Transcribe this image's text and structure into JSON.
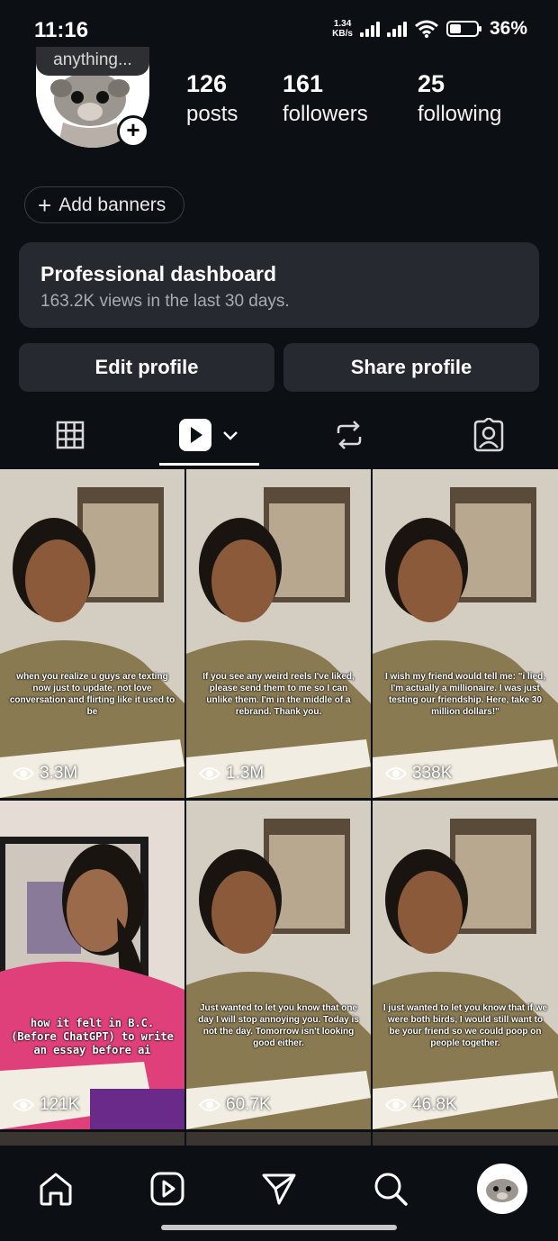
{
  "status_bar": {
    "time": "11:16",
    "net_speed_value": "1.34",
    "net_speed_unit": "KB/s",
    "battery_percent": "36%"
  },
  "profile": {
    "note": "anything...",
    "stats": [
      {
        "value": "126",
        "label": "posts"
      },
      {
        "value": "161",
        "label": "followers"
      },
      {
        "value": "25",
        "label": "following"
      }
    ],
    "add_banners_label": "Add banners"
  },
  "dashboard": {
    "title": "Professional dashboard",
    "subtitle": "163.2K views in the last 30 days."
  },
  "actions": {
    "edit_label": "Edit profile",
    "share_label": "Share profile"
  },
  "tabs": [
    {
      "name": "grid-icon"
    },
    {
      "name": "reels-icon",
      "active": true
    },
    {
      "name": "reposts-icon"
    },
    {
      "name": "tagged-icon"
    }
  ],
  "reels": [
    {
      "caption": "when you realize u guys are texting now just to update, not love conversation and flirting like it used to be",
      "views": "3.3M"
    },
    {
      "caption": "If you see any weird reels I've liked, please send them to me so I can unlike them. I'm in the middle of a rebrand. Thank you.",
      "views": "1.3M"
    },
    {
      "caption": "I wish my friend would tell me: \"i lied, I'm actually a millionaire. I was just testing our friendship. Here, take 30 million dollars!\"",
      "views": "338K"
    },
    {
      "caption": "how it felt in B.C. (Before ChatGPT) to write an essay before ai",
      "views": "121K"
    },
    {
      "caption": "Just wanted to let you know that one day I will stop annoying you. Today is not the day. Tomorrow isn't looking good either.",
      "views": "60.7K"
    },
    {
      "caption": "I just wanted to let you know that if we were both birds, I would still want to be your friend so we could poop on people together.",
      "views": "46.8K"
    }
  ],
  "nav": [
    "home-icon",
    "reels-nav-icon",
    "send-icon",
    "search-icon",
    "profile-avatar"
  ],
  "colors": {
    "background": "#0c1014",
    "card": "#262a30",
    "text": "#f5f5f5",
    "muted": "#a8acb2"
  }
}
